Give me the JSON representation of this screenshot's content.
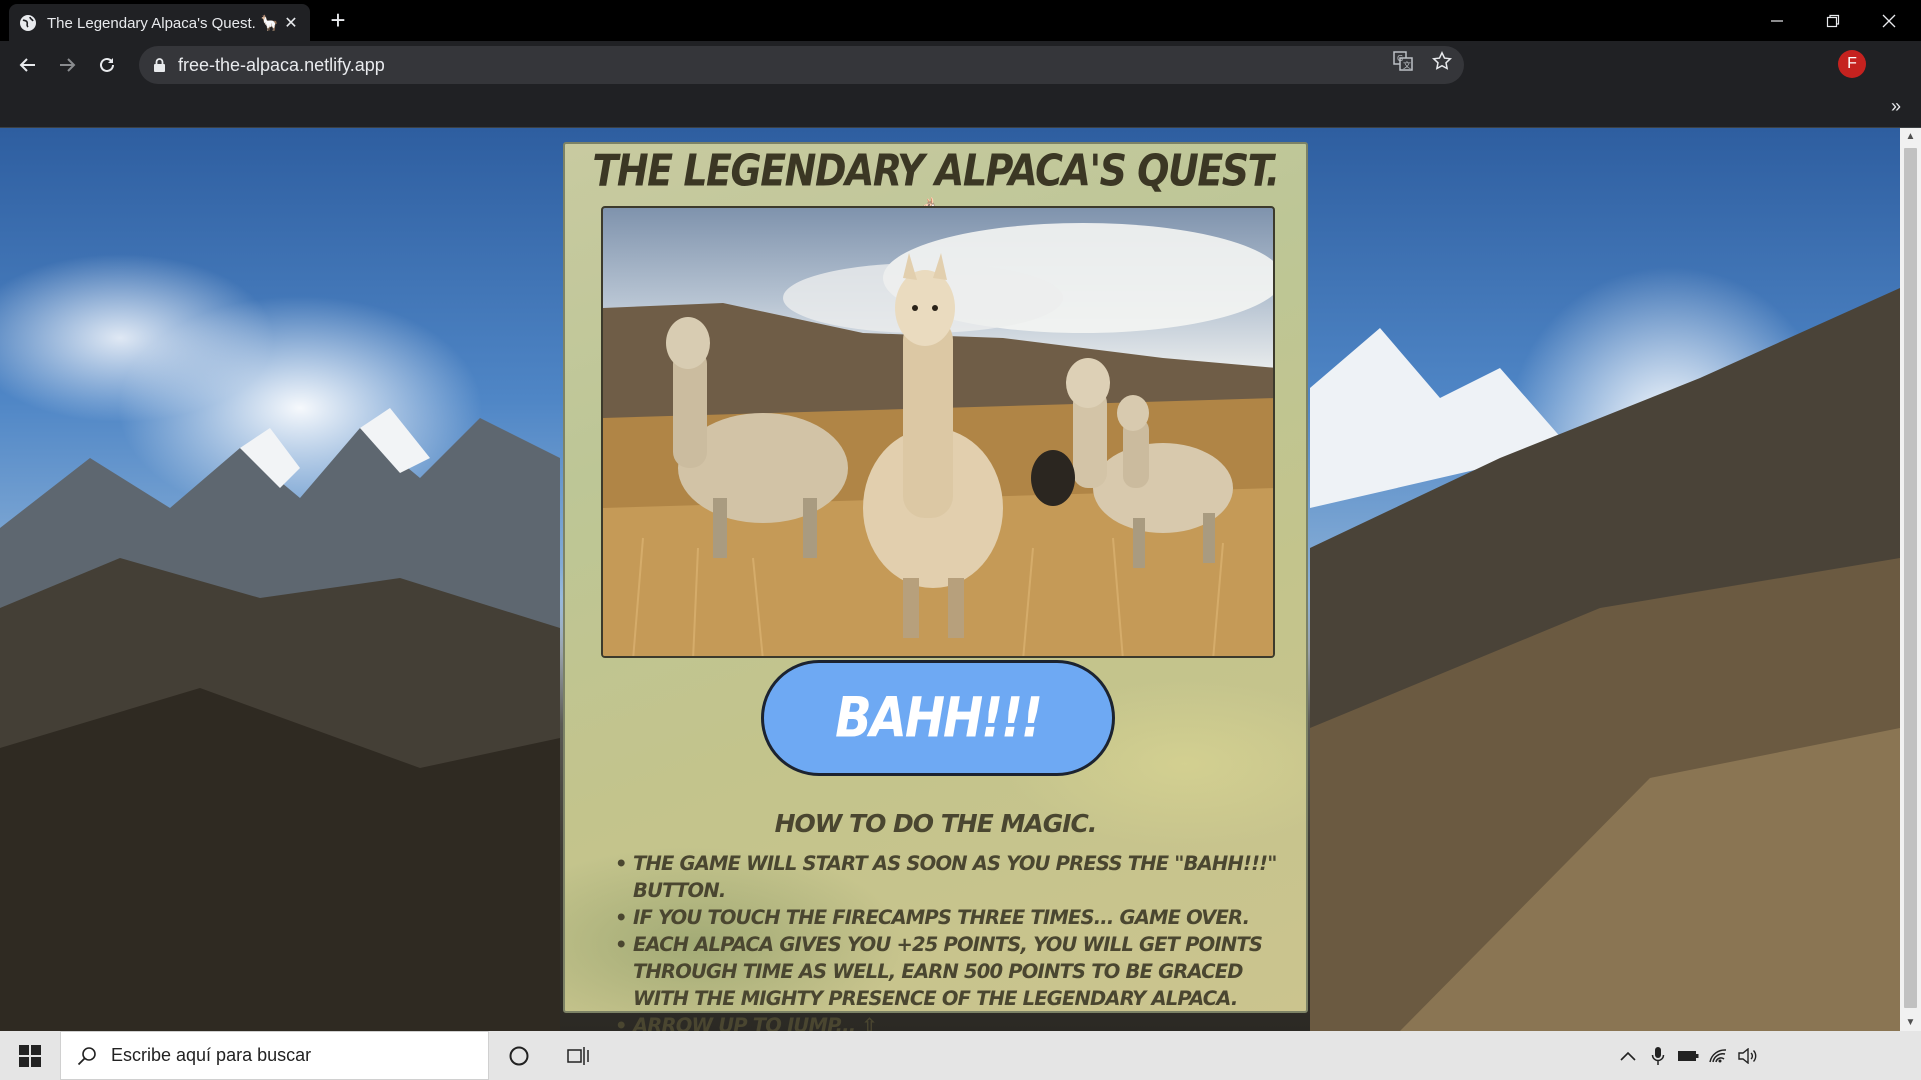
{
  "browser": {
    "tab_title": "The Legendary Alpaca's Quest. 🦙",
    "tab_close": "✕",
    "new_tab": "+",
    "url": "free-the-alpaca.netlify.app",
    "profile_initial": "F",
    "bookmarks_overflow": "»",
    "window_controls": {
      "minimize": "—",
      "restore": "❐",
      "close": "✕"
    }
  },
  "page": {
    "title": "THE LEGENDARY ALPACA'S QUEST. 🦙",
    "image_alt": "Alpacas standing in golden grassland",
    "start_button": "BAHH!!!",
    "how_to_heading": "HOW TO DO THE MAGIC.",
    "rules": [
      "THE GAME WILL START AS SOON AS YOU PRESS THE \"BAHH!!!\" BUTTON.",
      "IF YOU TOUCH THE FIRECAMPS THREE TIMES... GAME OVER.",
      "EACH ALPACA GIVES YOU +25 POINTS, YOU WILL GET POINTS THROUGH TIME AS WELL, EARN 500 POINTS TO BE GRACED WITH THE MIGHTY PRESENCE OF THE LEGENDARY ALPACA.",
      "ARROW UP TO JUMP... ⇧"
    ]
  },
  "taskbar": {
    "search_placeholder": "Escribe aquí para buscar"
  },
  "colors": {
    "button_blue": "#6ea9f3",
    "card_khaki": "#c3c48c",
    "text_dark_olive": "#4a4630",
    "profile_red": "#c5221f"
  },
  "icons": [
    "globe-icon",
    "back-arrow-icon",
    "forward-arrow-icon",
    "reload-icon",
    "lock-icon",
    "translate-icon",
    "star-icon",
    "windows-logo-icon",
    "search-icon",
    "cortana-icon",
    "task-view-icon",
    "chevron-up-icon",
    "microphone-icon",
    "battery-icon",
    "wifi-icon",
    "volume-icon"
  ]
}
